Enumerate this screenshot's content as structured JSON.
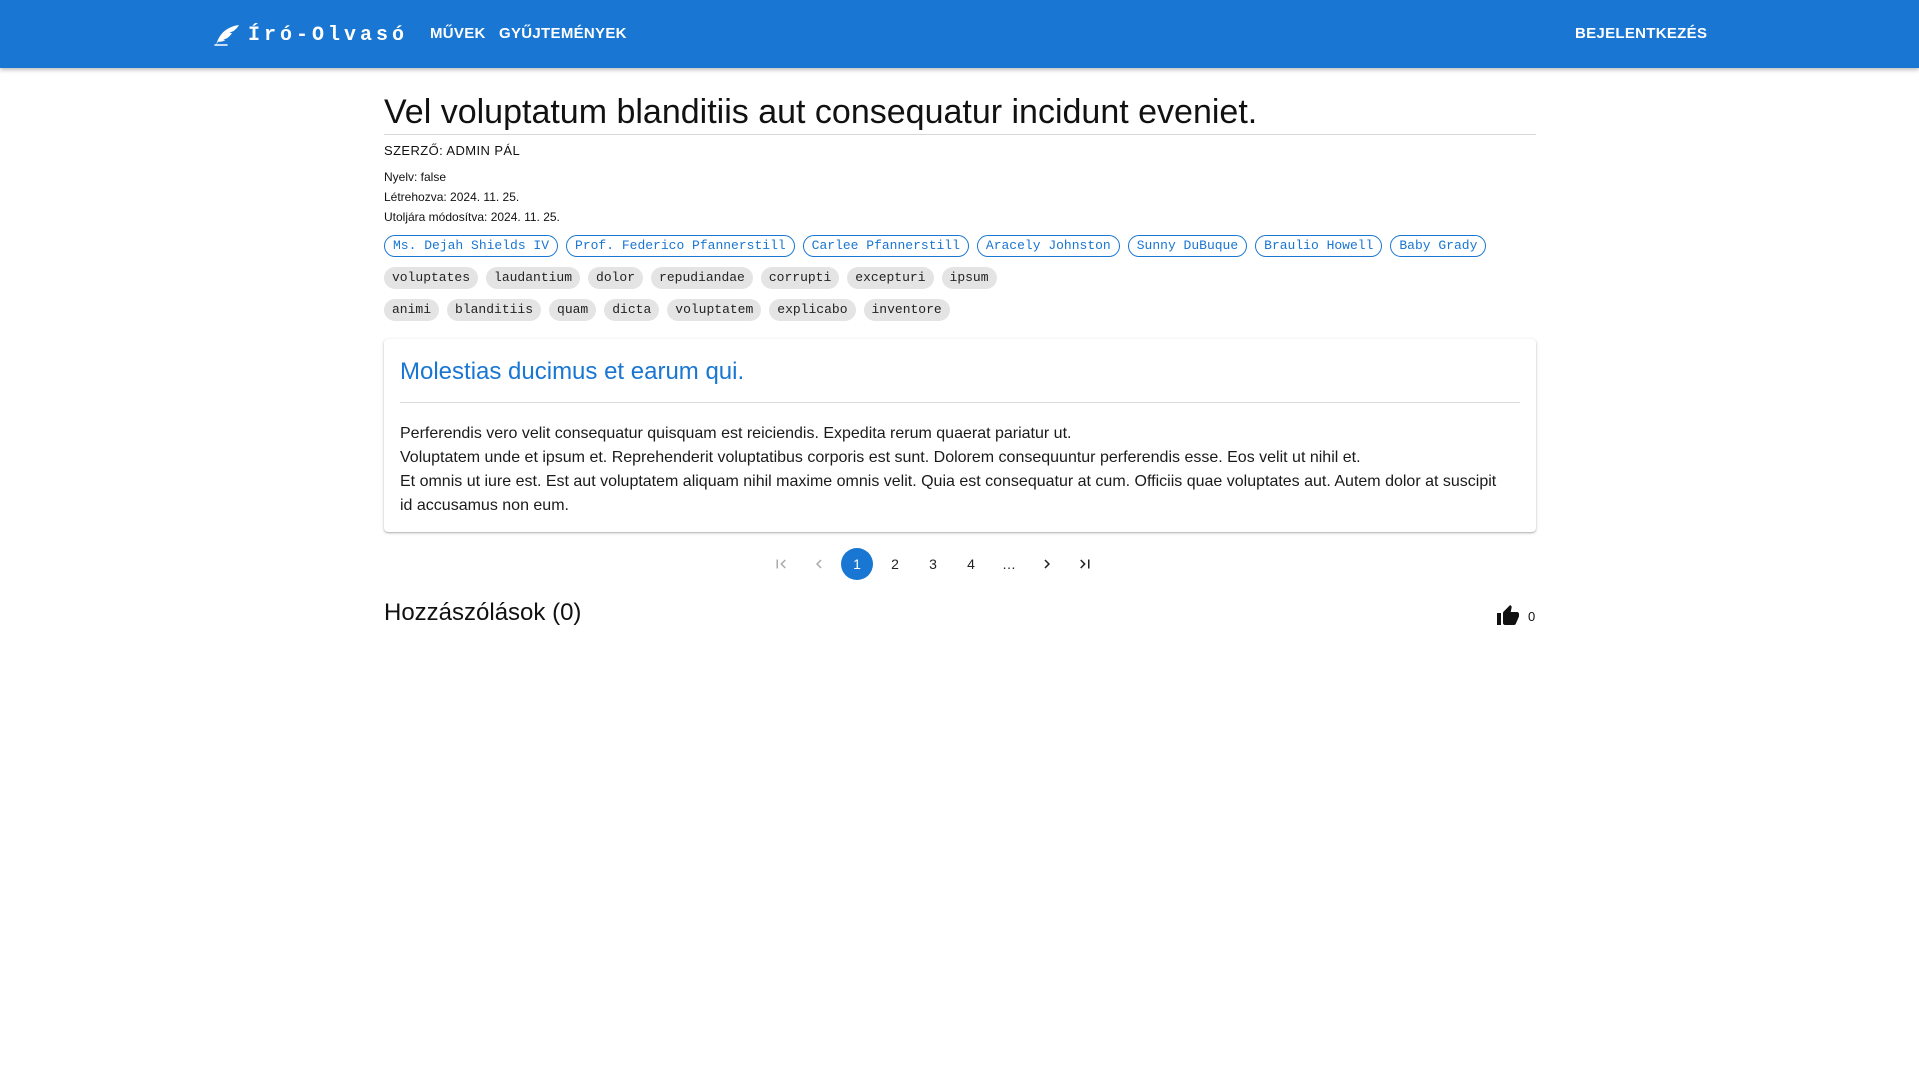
{
  "header": {
    "brand": "Író-Olvasó",
    "nav_works": "MŰVEK",
    "nav_collections": "GYŰJTEMÉNYEK",
    "login": "BEJELENTKEZÉS",
    "color": "#1976d2"
  },
  "work": {
    "title": "Vel voluptatum blanditiis aut consequatur incidunt eveniet.",
    "author": "SZERZŐ: ADMIN PÁL",
    "language": "Nyelv: false",
    "created": "Létrehozva: 2024. 11. 25.",
    "modified": "Utoljára módosítva: 2024. 11. 25.",
    "authors": [
      "Ms. Dejah Shields IV",
      "Prof. Federico Pfannerstill",
      "Carlee Pfannerstill",
      "Aracely Johnston",
      "Sunny DuBuque",
      "Braulio Howell",
      "Baby Grady"
    ],
    "tags_row1": [
      "voluptates",
      "laudantium",
      "dolor",
      "repudiandae",
      "corrupti",
      "excepturi",
      "ipsum"
    ],
    "tags_row2": [
      "animi",
      "blanditiis",
      "quam",
      "dicta",
      "voluptatem",
      "explicabo",
      "inventore"
    ]
  },
  "chapter": {
    "title": "Molestias ducimus et earum qui.",
    "paragraphs": [
      "Perferendis vero velit consequatur quisquam est reiciendis. Expedita rerum quaerat pariatur ut.",
      "Voluptatem unde et ipsum et. Reprehenderit voluptatibus corporis est sunt. Dolorem consequuntur perferendis esse. Eos velit ut nihil et.",
      "Et omnis ut iure est. Est aut voluptatem aliquam nihil maxime omnis velit. Quia est consequatur at cum. Officiis quae voluptates aut. Autem dolor at suscipit id accusamus non eum."
    ]
  },
  "pagination": {
    "pages": [
      "1",
      "2",
      "3",
      "4"
    ],
    "current": "1",
    "ellipsis": "…",
    "icons": [
      "first-page-icon",
      "previous-page-icon",
      "next-page-icon",
      "last-page-icon"
    ]
  },
  "comments": {
    "title": "Hozzászólások (0)",
    "like_count": "0",
    "like_icon": "thumb-up-icon"
  }
}
